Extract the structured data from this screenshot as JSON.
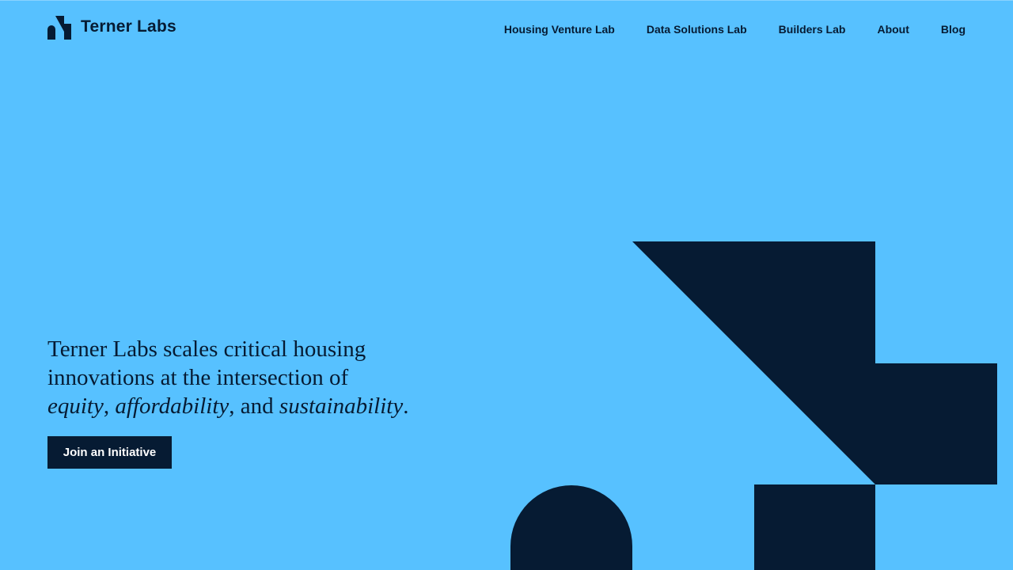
{
  "brand": {
    "name": "Terner Labs",
    "logo_icon": "terner-labs-mark-icon"
  },
  "nav": {
    "items": [
      {
        "label": "Housing Venture Lab"
      },
      {
        "label": "Data Solutions Lab"
      },
      {
        "label": "Builders Lab"
      },
      {
        "label": "About"
      },
      {
        "label": "Blog"
      }
    ]
  },
  "hero": {
    "line_intro": "Terner Labs scales critical housing innovations at the intersection of",
    "word_1": "equity",
    "sep_1": ",",
    "word_2": "affordability",
    "sep_2": ", and",
    "word_3": "sustainability",
    "end": ".",
    "cta_label": "Join an Initiative"
  },
  "colors": {
    "background": "#57c1ff",
    "navy": "#061b33",
    "cta_text": "#ffffff"
  },
  "decor": {
    "shape_icon": "geometric-brand-shapes"
  }
}
